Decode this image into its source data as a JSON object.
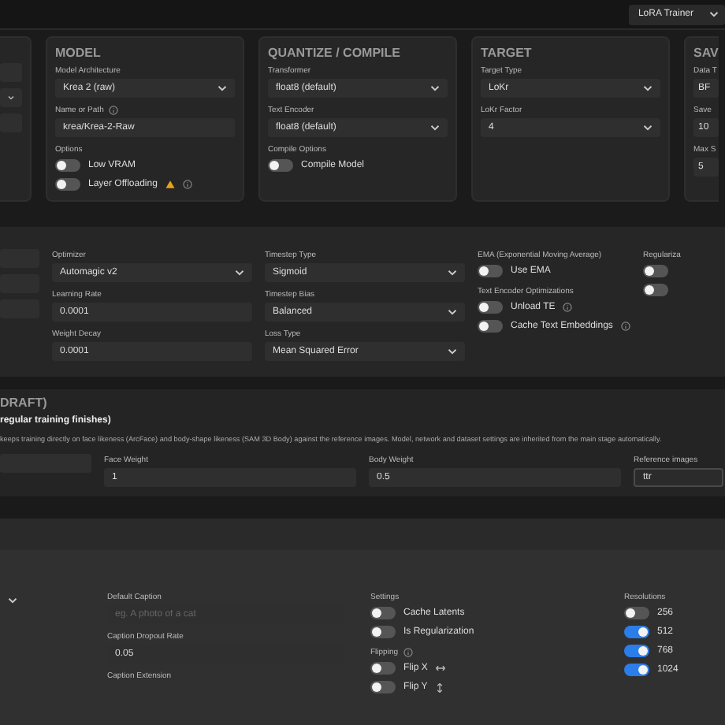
{
  "top_bar": {
    "mode_select": "LoRA Trainer"
  },
  "sections": [
    {
      "panels": [
        {
          "columns": [
            [
              {
                "kind": "input"
              },
              {
                "kind": "select"
              },
              {
                "kind": "input"
              }
            ]
          ]
        },
        {
          "title": "MODEL",
          "columns": [
            [
              {
                "kind": "select",
                "label": "Model Architecture",
                "value": "Krea 2 (raw)"
              },
              {
                "kind": "input",
                "label": "Name or Path",
                "info": true,
                "value": "krea/Krea-2-Raw"
              },
              {
                "kind": "toggles",
                "label": "Options",
                "items": [
                  {
                    "label": "Low VRAM",
                    "on": false
                  },
                  {
                    "label": "Layer Offloading",
                    "on": false,
                    "warning": true,
                    "info": true
                  }
                ]
              }
            ]
          ]
        },
        {
          "title": "QUANTIZE / COMPILE",
          "columns": [
            [
              {
                "kind": "select",
                "label": "Transformer",
                "value": "float8 (default)"
              },
              {
                "kind": "select",
                "label": "Text Encoder",
                "value": "float8 (default)"
              },
              {
                "kind": "toggles",
                "label": "Compile Options",
                "items": [
                  {
                    "label": "Compile Model",
                    "on": false
                  }
                ]
              }
            ]
          ]
        },
        {
          "title": "TARGET",
          "columns": [
            [
              {
                "kind": "select",
                "label": "Target Type",
                "value": "LoKr"
              },
              {
                "kind": "select",
                "label": "LoKr Factor",
                "value": "4"
              }
            ]
          ]
        },
        {
          "title": "SAV",
          "columns": [
            [
              {
                "kind": "input",
                "label": "Data T",
                "value": "BF"
              },
              {
                "kind": "input",
                "label": "Save",
                "value": "10"
              },
              {
                "kind": "input",
                "label": "Max S",
                "value": "5"
              }
            ]
          ]
        }
      ]
    },
    {
      "panels": [
        {
          "columns": [
            [
              {
                "kind": "input"
              },
              {
                "kind": "input"
              },
              {
                "kind": "input"
              }
            ],
            [
              {
                "kind": "select",
                "label": "Optimizer",
                "value": "Automagic v2"
              },
              {
                "kind": "input",
                "label": "Learning Rate",
                "value": "0.0001"
              },
              {
                "kind": "input",
                "label": "Weight Decay",
                "value": "0.0001"
              }
            ],
            [
              {
                "kind": "select",
                "label": "Timestep Type",
                "value": "Sigmoid"
              },
              {
                "kind": "select",
                "label": "Timestep Bias",
                "value": "Balanced"
              },
              {
                "kind": "select",
                "label": "Loss Type",
                "value": "Mean Squared Error"
              }
            ],
            [
              {
                "kind": "toggles",
                "label": "EMA (Exponential Moving Average)",
                "items": [
                  {
                    "label": "Use EMA",
                    "on": false
                  }
                ]
              },
              {
                "kind": "toggles",
                "label": "Text Encoder Optimizations",
                "items": [
                  {
                    "label": "Unload TE",
                    "on": false,
                    "info": true
                  },
                  {
                    "label": "Cache Text Embeddings",
                    "on": false,
                    "info": true
                  }
                ]
              }
            ],
            [
              {
                "kind": "toggles",
                "label": "Regulariza",
                "items": [
                  {
                    "on": false
                  },
                  {
                    "on": false
                  }
                ]
              }
            ]
          ]
        }
      ]
    },
    {
      "panels": [
        {
          "title": "DRAFT)",
          "subtitle": "regular training finishes)",
          "description": "keeps training directly on face likeness (ArcFace) and body-shape likeness (SAM 3D Body) against the reference images. Model, network and dataset settings are inherited from the main stage automatically.",
          "columns": [
            [
              {
                "kind": "input"
              }
            ],
            [
              {
                "kind": "input",
                "label": "Face Weight",
                "value": "1"
              }
            ],
            [
              {
                "kind": "input",
                "label": "Body Weight",
                "value": "0.5"
              }
            ],
            [
              {
                "kind": "input",
                "label": "Reference images",
                "value": "ttr"
              }
            ]
          ]
        }
      ]
    },
    {
      "panels": [
        {
          "columns": [
            [
              {
                "kind": "select"
              }
            ],
            [
              {
                "kind": "input",
                "label": "Default Caption",
                "placeholder": "eg. A photo of a cat"
              },
              {
                "kind": "input",
                "label": "Caption Dropout Rate",
                "value": "0.05"
              },
              {
                "kind": "label",
                "label": "Caption Extension"
              }
            ],
            [
              {
                "kind": "toggles",
                "label": "Settings",
                "items": [
                  {
                    "label": "Cache Latents",
                    "on": false
                  },
                  {
                    "label": "Is Regularization",
                    "on": false
                  }
                ]
              },
              {
                "kind": "toggles",
                "label": "Flipping",
                "info": true,
                "items": [
                  {
                    "label": "Flip X",
                    "on": false,
                    "kind": "horizontal"
                  },
                  {
                    "label": "Flip Y",
                    "on": false,
                    "kind": "vertical"
                  }
                ]
              }
            ],
            [
              {
                "kind": "toggles",
                "label": "Resolutions",
                "items": [
                  {
                    "label": "256",
                    "on": false
                  },
                  {
                    "label": "512",
                    "on": true
                  },
                  {
                    "label": "768",
                    "on": true
                  },
                  {
                    "label": "1024",
                    "on": true
                  }
                ]
              }
            ]
          ]
        }
      ]
    }
  ]
}
